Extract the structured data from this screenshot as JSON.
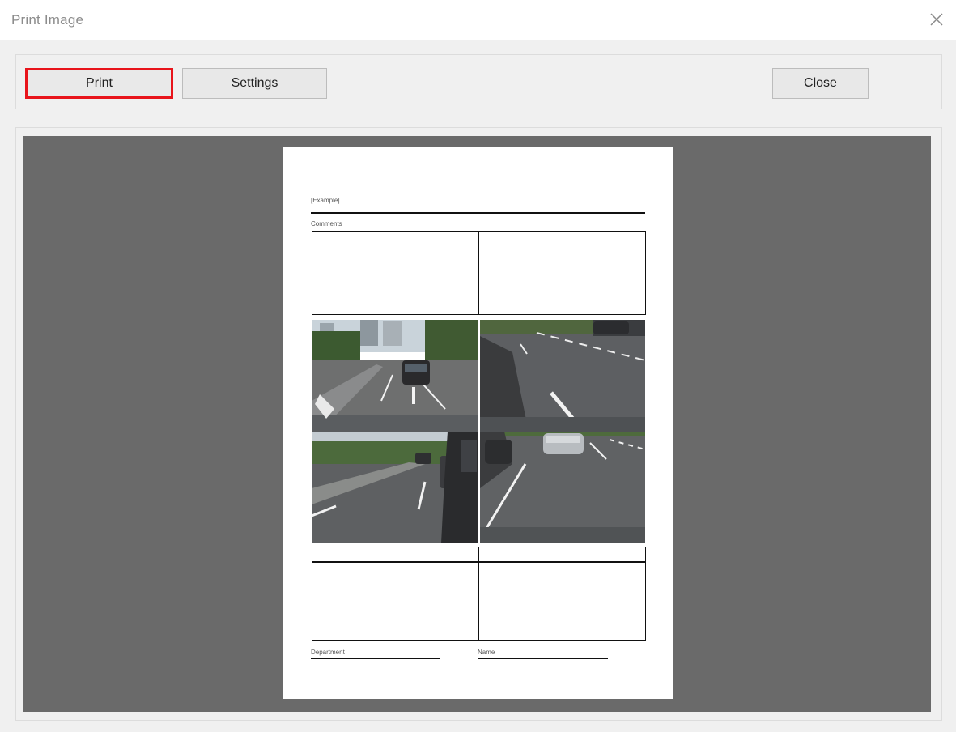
{
  "window": {
    "title": "Print Image",
    "close_icon": "close-icon"
  },
  "toolbar": {
    "print_label": "Print",
    "settings_label": "Settings",
    "close_label": "Close"
  },
  "document": {
    "header_label": "[Example]",
    "comments_label": "Comments",
    "department_label": "Department",
    "name_label": "Name",
    "photos": [
      "front-camera-view-icon",
      "right-side-camera-view-icon",
      "left-side-camera-view-icon",
      "rear-camera-view-icon"
    ]
  },
  "colors": {
    "highlight": "#e8141b",
    "preview_background": "#6a6a6a",
    "window_background": "#f0f0f0"
  }
}
